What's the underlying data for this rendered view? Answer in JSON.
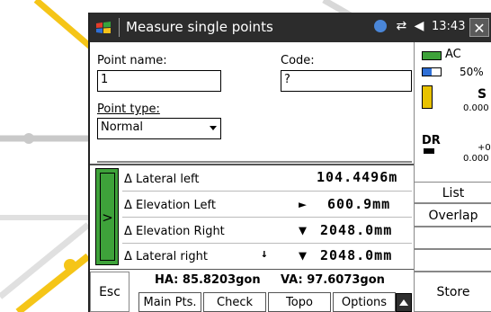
{
  "window": {
    "title": "Measure single points",
    "time": "13:43",
    "close_label": "✕"
  },
  "form": {
    "point_name_label": "Point name:",
    "point_name_value": "1",
    "code_label": "Code:",
    "code_value": "?",
    "point_type_label": "Point type:",
    "point_type_value": "Normal"
  },
  "status": {
    "power_label": "AC",
    "battery_percent": "50%",
    "instrument_s": "S",
    "instrument_value": "0.000",
    "dr_label": "DR",
    "dr_offset": "+0",
    "dr_value": "0.000"
  },
  "measurements": {
    "active_marker": ">",
    "rows": [
      {
        "label": "Δ Lateral left",
        "value": "104.4496m",
        "symbol": ""
      },
      {
        "label": "Δ Elevation Left",
        "value": "600.9mm",
        "symbol": "►"
      },
      {
        "label": "Δ Elevation Right",
        "value": "2048.0mm",
        "symbol": "▼"
      },
      {
        "label": "Δ Lateral right",
        "value": "2048.0mm",
        "symbol": "▼",
        "arrow": "↓"
      }
    ]
  },
  "side_buttons": {
    "list": "List",
    "overlap": "Overlap"
  },
  "bottom": {
    "esc": "Esc",
    "ha": "HA: 85.8203gon",
    "va": "VA: 97.6073gon",
    "tabs": [
      "Main Pts.",
      "Check",
      "Topo",
      "Options"
    ],
    "store": "Store"
  },
  "colors": {
    "titlebar": "#2c2c2c",
    "accent_green": "#3ea23a",
    "background_yellow": "#f5c518"
  }
}
